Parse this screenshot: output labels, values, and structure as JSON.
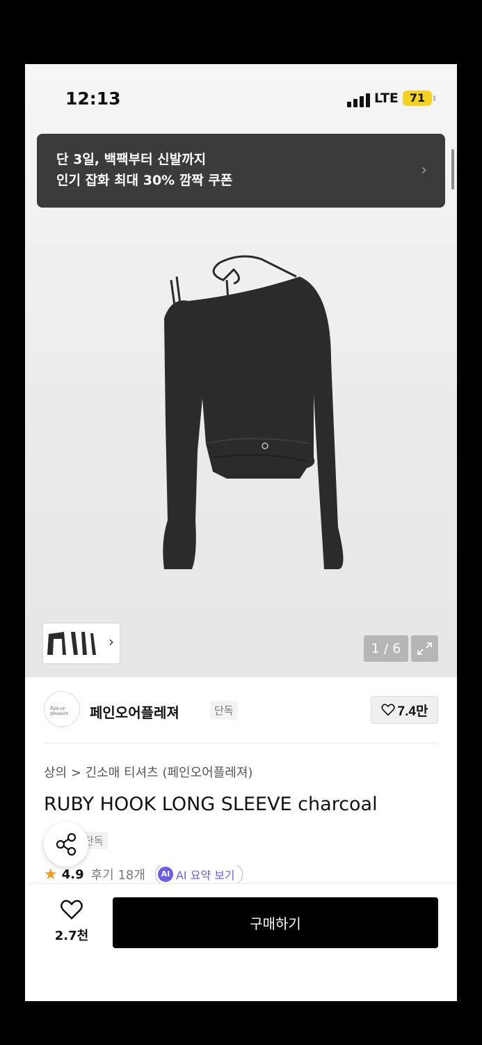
{
  "status_bar": {
    "time": "12:13",
    "network": "LTE",
    "battery": "71"
  },
  "banner": {
    "line1": "단 3일, 백팩부터 신발까지",
    "line2": "인기 잡화 최대 30% 깜짝 쿠폰",
    "chevron_icon": "chevron-right-icon"
  },
  "gallery": {
    "counter": "1 / 6",
    "thumbnail_chevron": "›",
    "expand_icon": "expand-icon"
  },
  "brand": {
    "logo_text": "Pain or pleasure",
    "name": "페인오어플레져",
    "tag": "단독",
    "likes": "7.4만"
  },
  "product": {
    "breadcrumb": "상의 > 긴소매 티셔츠 (페인오어플레져)",
    "title": "RUBY HOOK LONG SLEEVE charcoal",
    "exclusive_tag": "단독",
    "rating": "4.9",
    "reviews": "후기 18개",
    "ai_badge": "AI",
    "ai_summary": "AI 요약 보기"
  },
  "bottom_bar": {
    "wish_count": "2.7천",
    "buy_label": "구매하기"
  },
  "colors": {
    "banner_bg": "#3b3b3b",
    "buy_button": "#000000",
    "star": "#f39a1f",
    "ai_accent": "#6c5ce7",
    "battery": "#f4d21f"
  }
}
